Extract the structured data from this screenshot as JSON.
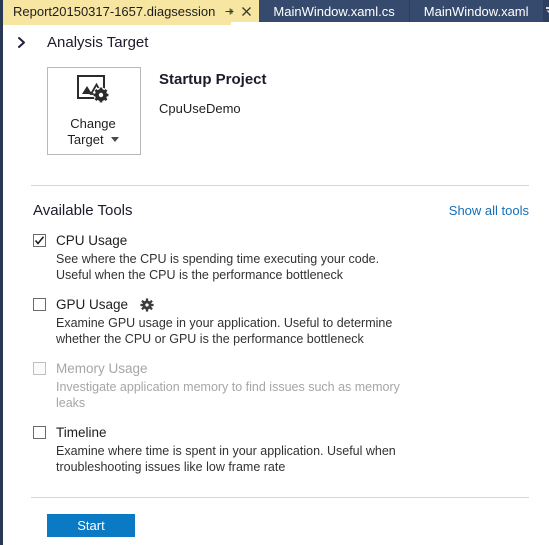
{
  "tabs": {
    "active": {
      "label": "Report20150317-1657.diagsession",
      "pin_icon": "pin-icon",
      "close_icon": "close-icon"
    },
    "inactive": [
      {
        "label": "MainWindow.xaml.cs"
      },
      {
        "label": "MainWindow.xaml"
      }
    ],
    "overflow_icon": "chevron-down-icon"
  },
  "analysis_target": {
    "expander_icon": "chevron-right-icon",
    "title": "Analysis Target",
    "change_target": {
      "icon": "picture-settings-icon",
      "label_line1": "Change",
      "label_line2": "Target",
      "dropdown_icon": "caret-down-icon"
    },
    "startup_project_label": "Startup Project",
    "startup_project_value": "CpuUseDemo"
  },
  "available_tools": {
    "title": "Available Tools",
    "show_all_label": "Show all tools",
    "tools": [
      {
        "name": "CPU Usage",
        "checked": true,
        "enabled": true,
        "has_gear": false,
        "description": "See where the CPU is spending time executing your code. Useful when the CPU is the performance bottleneck"
      },
      {
        "name": "GPU Usage",
        "checked": false,
        "enabled": true,
        "has_gear": true,
        "gear_icon": "gear-icon",
        "description": "Examine GPU usage in your application. Useful to determine whether the CPU or GPU is the performance bottleneck"
      },
      {
        "name": "Memory Usage",
        "checked": false,
        "enabled": false,
        "has_gear": false,
        "description": "Investigate application memory to find issues such as memory leaks"
      },
      {
        "name": "Timeline",
        "checked": false,
        "enabled": true,
        "has_gear": false,
        "description": "Examine where time is spent in your application. Useful when troubleshooting issues like low frame rate"
      }
    ]
  },
  "footer": {
    "start_label": "Start"
  },
  "colors": {
    "accent_blue": "#0a7ac4",
    "link_blue": "#1570b8",
    "tab_active_bg": "#f6e6a2",
    "tab_inactive_bg": "#364a6e",
    "tabstrip_bg": "#2d3e5f",
    "window_border": "#293955"
  }
}
